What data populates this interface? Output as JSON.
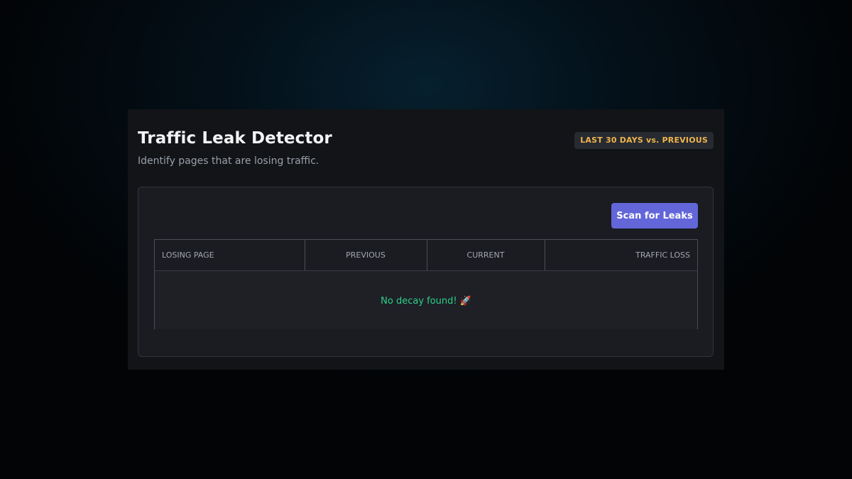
{
  "header": {
    "title": "Traffic Leak Detector",
    "subtitle": "Identify pages that are losing traffic.",
    "range_badge": "LAST 30 DAYS vs. PREVIOUS"
  },
  "toolbar": {
    "scan_label": "Scan for Leaks"
  },
  "table": {
    "columns": [
      "LOSING PAGE",
      "PREVIOUS",
      "CURRENT",
      "TRAFFIC LOSS"
    ],
    "rows": [],
    "empty_message": "No decay found!",
    "empty_icon": "rocket-icon",
    "empty_icon_glyph": "🚀"
  },
  "colors": {
    "accent": "#6366d9",
    "badge_text": "#f0b44c",
    "success": "#2fcf8a"
  }
}
